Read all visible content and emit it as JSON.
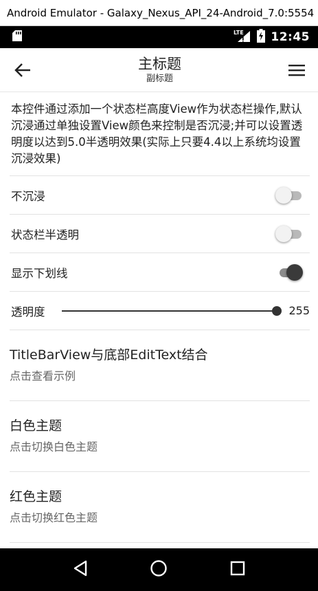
{
  "window": {
    "title": "Android Emulator - Galaxy_Nexus_API_24-Android_7.0:5554"
  },
  "status_bar": {
    "time": "12:45",
    "network_label": "LTE",
    "icons": [
      "sd-card-icon",
      "signal-icon",
      "battery-charging-icon"
    ]
  },
  "app_bar": {
    "title": "主标题",
    "subtitle": "副标题",
    "icons": {
      "back": "arrow-left-icon",
      "menu": "hamburger-menu-icon"
    }
  },
  "description": "本控件通过添加一个状态栏高度View作为状态栏操作,默认沉浸通过单独设置View颜色来控制是否沉浸;并可以设置透明度以达到5.0半透明效果(实际上只要4.4以上系统均设置沉浸效果)",
  "settings": [
    {
      "label": "不沉浸",
      "checked": false
    },
    {
      "label": "状态栏半透明",
      "checked": false
    },
    {
      "label": "显示下划线",
      "checked": true
    }
  ],
  "transparency": {
    "label": "透明度",
    "value": 255,
    "value_text": "255",
    "max": 255
  },
  "items": [
    {
      "title": "TitleBarView与底部EditText结合",
      "subtitle": "点击查看示例"
    },
    {
      "title": "白色主题",
      "subtitle": "点击切换白色主题"
    },
    {
      "title": "红色主题",
      "subtitle": "点击切换红色主题"
    }
  ],
  "nav_bar": {
    "icons": [
      "back-triangle-icon",
      "home-circle-icon",
      "recents-square-icon"
    ]
  },
  "colors": {
    "status_bar": "#000000",
    "nav_bar": "#000000",
    "switch_on_thumb": "#3a3a3a",
    "switch_off_thumb": "#f2f2f2"
  }
}
